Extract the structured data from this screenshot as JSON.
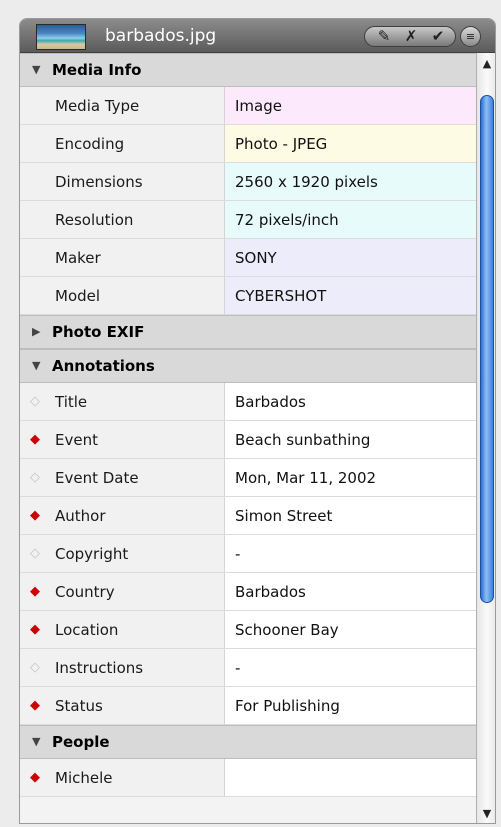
{
  "window": {
    "title": "barbados.jpg",
    "thumbnail_icon": "image-thumbnail",
    "toolbar": {
      "edit_icon": "✎",
      "cancel_icon": "✗",
      "confirm_icon": "✔",
      "menu_icon": "≡"
    }
  },
  "sections": {
    "media_info": {
      "label": "Media Info",
      "expanded": true,
      "rows": [
        {
          "label": "Media Type",
          "value": "Image",
          "color": "#fce9fb"
        },
        {
          "label": "Encoding",
          "value": "Photo - JPEG",
          "color": "#fdfbe3"
        },
        {
          "label": "Dimensions",
          "value": "2560 x 1920 pixels",
          "color": "#e7fbfb"
        },
        {
          "label": "Resolution",
          "value": "72 pixels/inch",
          "color": "#e7fbfb"
        },
        {
          "label": "Maker",
          "value": "SONY",
          "color": "#ececfb"
        },
        {
          "label": "Model",
          "value": "CYBERSHOT",
          "color": "#ececfb"
        }
      ]
    },
    "photo_exif": {
      "label": "Photo EXIF",
      "expanded": false
    },
    "annotations": {
      "label": "Annotations",
      "expanded": true,
      "rows": [
        {
          "label": "Title",
          "value": "Barbados",
          "required": false
        },
        {
          "label": "Event",
          "value": "Beach sunbathing",
          "required": true
        },
        {
          "label": "Event Date",
          "value": "Mon, Mar 11, 2002",
          "required": false
        },
        {
          "label": "Author",
          "value": "Simon Street",
          "required": true
        },
        {
          "label": "Copyright",
          "value": "-",
          "required": false
        },
        {
          "label": "Country",
          "value": "Barbados",
          "required": true
        },
        {
          "label": "Location",
          "value": "Schooner Bay",
          "required": true
        },
        {
          "label": "Instructions",
          "value": "-",
          "required": false
        },
        {
          "label": "Status",
          "value": "For Publishing",
          "required": true
        }
      ]
    },
    "people": {
      "label": "People",
      "expanded": true,
      "rows": [
        {
          "label": "Michele",
          "value": "",
          "required": true
        }
      ]
    }
  },
  "icons": {
    "expanded_arrow": "▼",
    "collapsed_arrow": "▶",
    "required_diamond": "◆",
    "optional_diamond": "◇",
    "scroll_up": "▲",
    "scroll_down": "▼"
  },
  "colors": {
    "required": "#cc0000",
    "scroll_thumb": "#3b7fdc"
  }
}
